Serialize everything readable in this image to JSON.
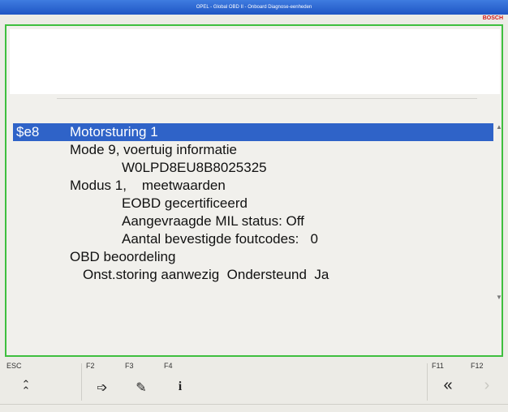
{
  "window": {
    "title": "OPEL - Global OBD II - Onboard Diagnose-eenheden"
  },
  "brand": {
    "name": "BOSCH",
    "color": "#d01818"
  },
  "accent_colors": {
    "frame_border": "#3fbf3f",
    "selection": "#2f63c8",
    "titlebar": "#1f55c4"
  },
  "list": {
    "rows": [
      {
        "code": "$e8",
        "text": "Motorsturing 1",
        "selected": true
      },
      {
        "code": "",
        "text": "Mode 9, voertuig informatie",
        "selected": false
      },
      {
        "code": "",
        "text": "W0LPD8EU8B8025325",
        "selected": false
      },
      {
        "code": "",
        "text": "Modus 1,    meetwaarden",
        "selected": false
      },
      {
        "code": "",
        "text": "EOBD gecertificeerd",
        "selected": false
      },
      {
        "code": "",
        "text": "Aangevraagde MIL status: Off",
        "selected": false
      },
      {
        "code": "",
        "text": "Aantal bevestigde foutcodes:   0",
        "selected": false
      },
      {
        "code": "",
        "text": "OBD beoordeling",
        "selected": false
      },
      {
        "code": "",
        "text": "Onst.storing aanwezig  Ondersteund  Ja",
        "selected": false
      }
    ],
    "scroll_up_icon": "▲",
    "scroll_down_icon": "▼"
  },
  "function_keys": [
    {
      "label": "ESC",
      "icon_name": "double-chevron-up-icon",
      "glyph": "⌃",
      "enabled": true
    },
    {
      "label": "F2",
      "icon_name": "arrow-right-icon",
      "glyph": "➩",
      "enabled": true
    },
    {
      "label": "F3",
      "icon_name": "pencil-icon",
      "glyph": "✎",
      "enabled": true
    },
    {
      "label": "F4",
      "icon_name": "info-icon",
      "glyph": "i",
      "enabled": true
    },
    {
      "label": "F11",
      "icon_name": "double-chevron-left-icon",
      "glyph": "«",
      "enabled": true
    },
    {
      "label": "F12",
      "icon_name": "chevron-right-icon",
      "glyph": "›",
      "enabled": false
    }
  ]
}
